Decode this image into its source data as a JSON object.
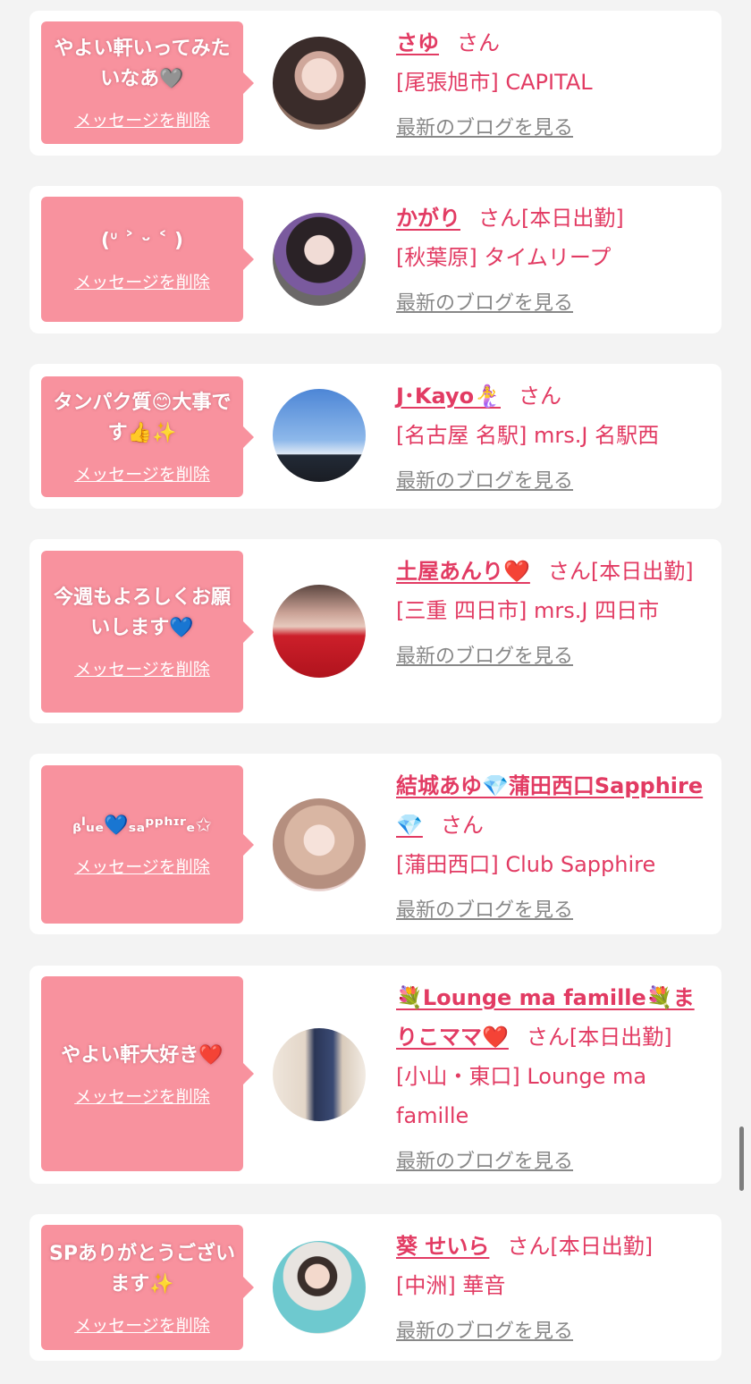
{
  "delete_label": "メッセージを削除",
  "san_label": "さん",
  "blog_label": "最新のブログを見る",
  "colors": {
    "bubble": "#f8929e",
    "accent": "#e23b63",
    "muted": "#888888",
    "background": "#f3f3f3"
  },
  "cards": [
    {
      "message": "やよい軒いってみたいなあ🩶",
      "name": "さゆ",
      "suffix": "",
      "shop": "[尾張旭市] CAPITAL"
    },
    {
      "message": "(ᐡ ˃ ᵕ ˂ )",
      "name": "かがり",
      "suffix": "[本日出勤]",
      "shop": "[秋葉原] タイムリープ"
    },
    {
      "message": "タンパク質😊大事です👍✨",
      "name": "J･Kayo🧜‍♀️",
      "suffix": "",
      "shop": "[名古屋 名駅] mrs.J 名駅西"
    },
    {
      "message": "今週もよろしくお願いします💙",
      "name": "土屋あんり❤️",
      "suffix": "[本日出勤]",
      "shop": "[三重 四日市] mrs.J 四日市"
    },
    {
      "message": "ᵦˡᵤₑ💙ₛₐᵖᵖʰᶦʳₑ✩",
      "name": "結城あゆ💎蒲田西口Sapphire💎",
      "suffix": "",
      "shop": "[蒲田西口] Club Sapphire"
    },
    {
      "message": "やよい軒大好き❤️",
      "name": "💐Lounge ma famille💐まりこママ❤️",
      "suffix": "[本日出勤]",
      "shop": "[小山・東口] Lounge ma famille"
    },
    {
      "message": "SPありがとうございます✨",
      "name": "葵 せいら",
      "suffix": "[本日出勤]",
      "shop": "[中洲] 華音"
    }
  ]
}
